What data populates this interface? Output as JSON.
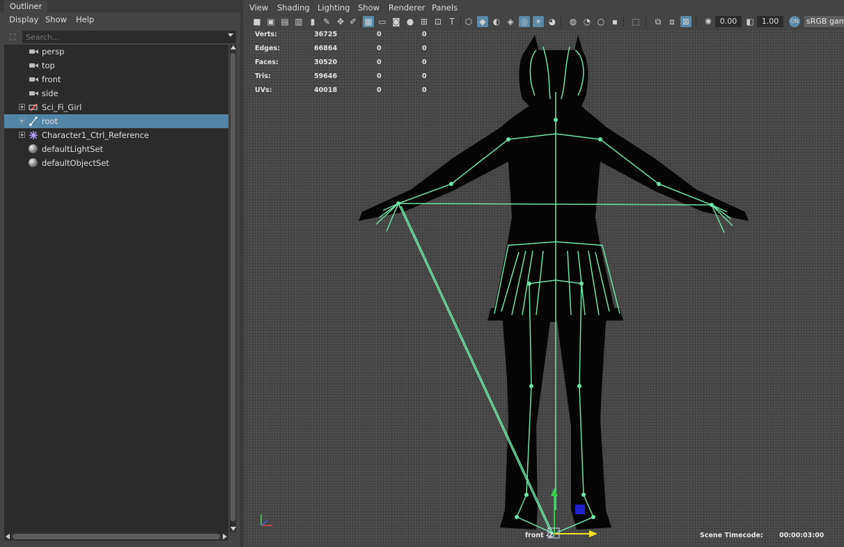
{
  "outliner": {
    "tab": "Outliner",
    "menus": [
      "Display",
      "Show",
      "Help"
    ],
    "search_placeholder": "Search...",
    "items": [
      {
        "label": "persp",
        "icon": "camera-icon",
        "expandable": false,
        "selected": false
      },
      {
        "label": "top",
        "icon": "camera-icon",
        "expandable": false,
        "selected": false
      },
      {
        "label": "front",
        "icon": "camera-icon",
        "expandable": false,
        "selected": false
      },
      {
        "label": "side",
        "icon": "camera-icon",
        "expandable": false,
        "selected": false
      },
      {
        "label": "Sci_Fi_Girl",
        "icon": "mesh-group-icon",
        "expandable": true,
        "selected": false
      },
      {
        "label": "root",
        "icon": "joint-icon",
        "expandable": true,
        "selected": true
      },
      {
        "label": "Character1_Ctrl_Reference",
        "icon": "hik-reference-icon",
        "expandable": true,
        "selected": false
      },
      {
        "label": "defaultLightSet",
        "icon": "set-icon",
        "expandable": false,
        "selected": false
      },
      {
        "label": "defaultObjectSet",
        "icon": "set-icon",
        "expandable": false,
        "selected": false
      }
    ]
  },
  "viewport": {
    "menus": [
      "View",
      "Shading",
      "Lighting",
      "Show",
      "Renderer",
      "Panels"
    ],
    "exposure": "0.00",
    "gamma": "1.00",
    "color_space": "sRGB gam",
    "hud": [
      {
        "label": "Verts:",
        "v1": "36725",
        "v2": "0",
        "v3": "0"
      },
      {
        "label": "Edges:",
        "v1": "66864",
        "v2": "0",
        "v3": "0"
      },
      {
        "label": "Faces:",
        "v1": "30520",
        "v2": "0",
        "v3": "0"
      },
      {
        "label": "Tris:",
        "v1": "59646",
        "v2": "0",
        "v3": "0"
      },
      {
        "label": "UVs:",
        "v1": "40018",
        "v2": "0",
        "v3": "0"
      }
    ],
    "camera_name": "front -Z",
    "timecode_label": "Scene Timecode:",
    "timecode_value": "00:00:03:00"
  },
  "colors": {
    "selection": "#5285a6",
    "skeleton": "#6fe6a8",
    "panel": "#444444",
    "field": "#2b2b2b"
  }
}
